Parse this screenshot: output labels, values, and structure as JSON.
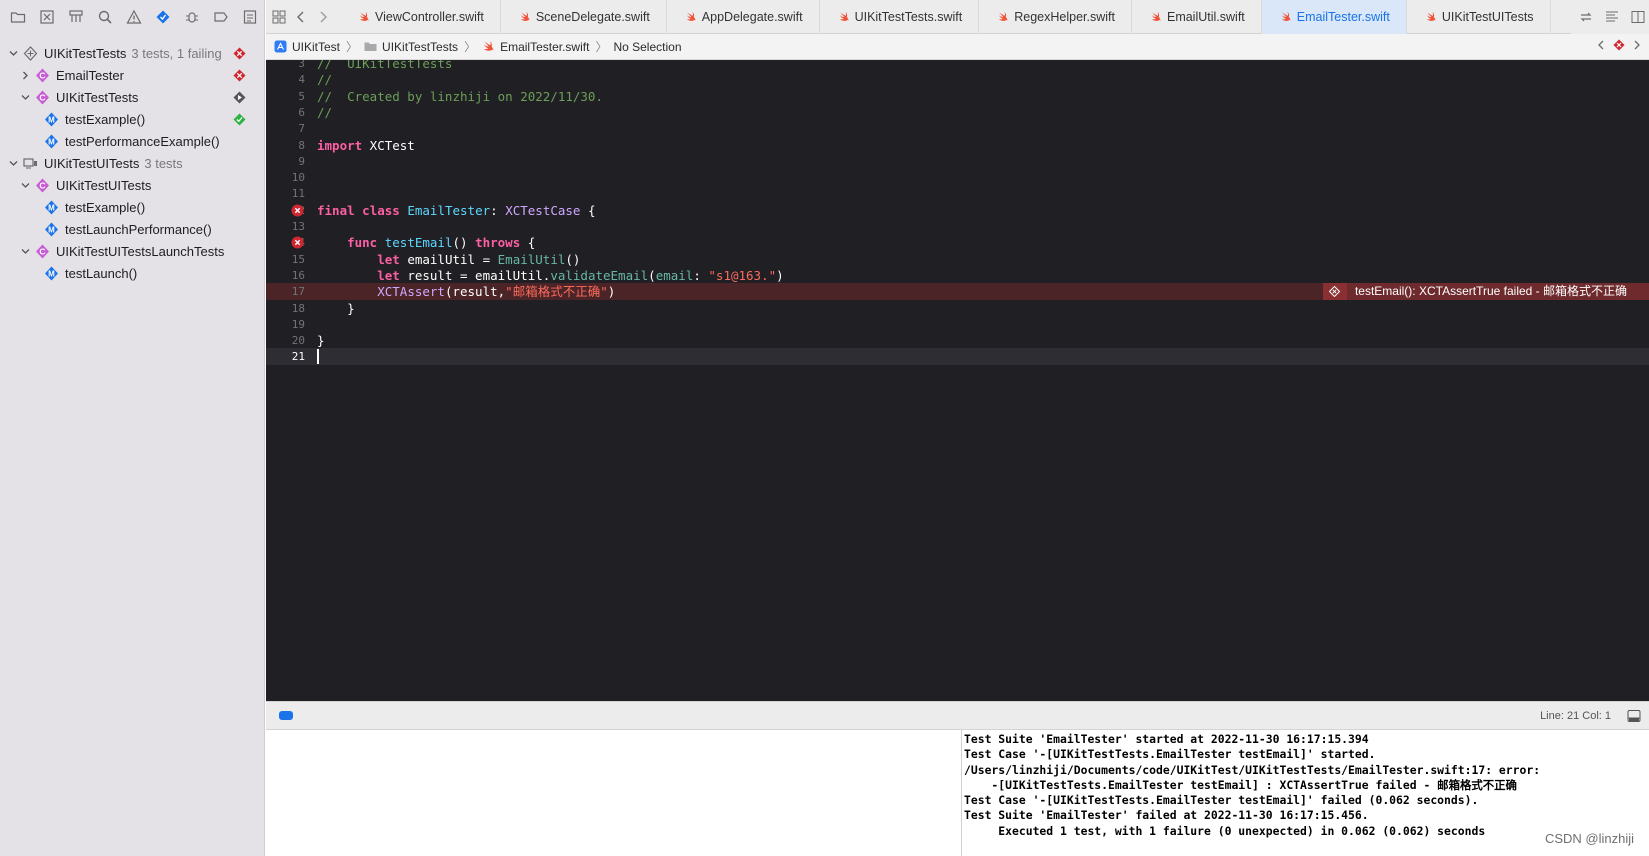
{
  "sidebar": {
    "toolbar_icons": [
      "folder-icon",
      "source-control-icon",
      "symbol-icon",
      "search-icon",
      "warning-icon",
      "test-navigator-icon",
      "debug-icon",
      "breakpoint-icon",
      "report-icon"
    ],
    "tree": [
      {
        "label": "UIKitTestTests",
        "sub": "3 tests, 1 failing",
        "indent": 0,
        "expanded": true,
        "icon": "test-bundle-icon",
        "status": "failed"
      },
      {
        "label": "EmailTester",
        "sub": "",
        "indent": 1,
        "expanded": false,
        "icon": "class-icon",
        "status": "failed"
      },
      {
        "label": "UIKitTestTests",
        "sub": "",
        "indent": 1,
        "expanded": true,
        "icon": "class-icon",
        "status": "run"
      },
      {
        "label": "testExample()",
        "sub": "",
        "indent": 2,
        "expanded": null,
        "icon": "test-method-icon",
        "status": "passed"
      },
      {
        "label": "testPerformanceExample()",
        "sub": "",
        "indent": 2,
        "expanded": null,
        "icon": "test-method-icon",
        "status": ""
      },
      {
        "label": "UIKitTestUITests",
        "sub": "3 tests",
        "indent": 0,
        "expanded": true,
        "icon": "ui-test-bundle-icon",
        "status": ""
      },
      {
        "label": "UIKitTestUITests",
        "sub": "",
        "indent": 1,
        "expanded": true,
        "icon": "class-icon",
        "status": ""
      },
      {
        "label": "testExample()",
        "sub": "",
        "indent": 2,
        "expanded": null,
        "icon": "test-method-icon",
        "status": ""
      },
      {
        "label": "testLaunchPerformance()",
        "sub": "",
        "indent": 2,
        "expanded": null,
        "icon": "test-method-icon",
        "status": ""
      },
      {
        "label": "UIKitTestUITestsLaunchTests",
        "sub": "",
        "indent": 1,
        "expanded": true,
        "icon": "class-icon",
        "status": ""
      },
      {
        "label": "testLaunch()",
        "sub": "",
        "indent": 2,
        "expanded": null,
        "icon": "test-method-icon",
        "status": ""
      }
    ]
  },
  "tabs": [
    {
      "label": "ViewController.swift",
      "active": false
    },
    {
      "label": "SceneDelegate.swift",
      "active": false
    },
    {
      "label": "AppDelegate.swift",
      "active": false
    },
    {
      "label": "UIKitTestTests.swift",
      "active": false
    },
    {
      "label": "RegexHelper.swift",
      "active": false
    },
    {
      "label": "EmailUtil.swift",
      "active": false
    },
    {
      "label": "EmailTester.swift",
      "active": true
    },
    {
      "label": "UIKitTestUITests",
      "active": false
    }
  ],
  "jumpbar": {
    "project": "UIKitTest",
    "group": "UIKitTestTests",
    "file": "EmailTester.swift",
    "selection": "No Selection"
  },
  "editor": {
    "lines": [
      {
        "n": "3",
        "tokens": [
          [
            "cm",
            "//  UIKitTestTests"
          ]
        ]
      },
      {
        "n": "4",
        "tokens": [
          [
            "cm",
            "//"
          ]
        ]
      },
      {
        "n": "5",
        "tokens": [
          [
            "cm",
            "//  Created by linzhiji on 2022/11/30."
          ]
        ]
      },
      {
        "n": "6",
        "tokens": [
          [
            "cm",
            "//"
          ]
        ]
      },
      {
        "n": "7",
        "tokens": []
      },
      {
        "n": "8",
        "tokens": [
          [
            "kw",
            "import"
          ],
          [
            "",
            " XCTest"
          ]
        ]
      },
      {
        "n": "9",
        "tokens": []
      },
      {
        "n": "10",
        "tokens": []
      },
      {
        "n": "11",
        "tokens": []
      },
      {
        "n": "12",
        "error_badge": true,
        "tokens": [
          [
            "kw",
            "final"
          ],
          [
            "",
            " "
          ],
          [
            "kw",
            "class"
          ],
          [
            "",
            " "
          ],
          [
            "ty",
            "EmailTester"
          ],
          [
            "",
            ": "
          ],
          [
            "cls",
            "XCTestCase"
          ],
          [
            "",
            " {"
          ]
        ]
      },
      {
        "n": "13",
        "tokens": []
      },
      {
        "n": "14",
        "error_badge": true,
        "tokens": [
          [
            "",
            "    "
          ],
          [
            "kw",
            "func"
          ],
          [
            "",
            " "
          ],
          [
            "ty",
            "testEmail"
          ],
          [
            "",
            "() "
          ],
          [
            "kw",
            "throws"
          ],
          [
            "",
            " {"
          ]
        ]
      },
      {
        "n": "15",
        "tokens": [
          [
            "",
            "        "
          ],
          [
            "kw",
            "let"
          ],
          [
            "",
            " emailUtil = "
          ],
          [
            "fn",
            "EmailUtil"
          ],
          [
            "",
            "()"
          ]
        ]
      },
      {
        "n": "16",
        "tokens": [
          [
            "",
            "        "
          ],
          [
            "kw",
            "let"
          ],
          [
            "",
            " result = emailUtil."
          ],
          [
            "fn",
            "validateEmail"
          ],
          [
            "",
            "("
          ],
          [
            "par",
            "email"
          ],
          [
            "",
            ": "
          ],
          [
            "str",
            "\"s1@163.\""
          ],
          [
            "",
            ")"
          ]
        ]
      },
      {
        "n": "17",
        "error": true,
        "tokens": [
          [
            "",
            "        "
          ],
          [
            "cls",
            "XCTAssert"
          ],
          [
            "",
            "(result,"
          ],
          [
            "str",
            "\"邮箱格式不正确\""
          ],
          [
            "",
            ")"
          ]
        ]
      },
      {
        "n": "18",
        "tokens": [
          [
            "",
            "    }"
          ]
        ]
      },
      {
        "n": "19",
        "tokens": []
      },
      {
        "n": "20",
        "tokens": [
          [
            "",
            "}"
          ]
        ]
      },
      {
        "n": "21",
        "current": true,
        "tokens": []
      }
    ],
    "inline_error": "testEmail(): XCTAssertTrue failed - 邮箱格式不正确"
  },
  "debugbar": {
    "line_col": "Line: 21  Col: 1"
  },
  "console": {
    "lines": [
      "Test Suite 'EmailTester' started at 2022-11-30 16:17:15.394",
      "Test Case '-[UIKitTestTests.EmailTester testEmail]' started.",
      "/Users/linzhiji/Documents/code/UIKitTest/UIKitTestTests/EmailTester.swift:17: error:",
      "    -[UIKitTestTests.EmailTester testEmail] : XCTAssertTrue failed - 邮箱格式不正确",
      "Test Case '-[UIKitTestTests.EmailTester testEmail]' failed (0.062 seconds).",
      "Test Suite 'EmailTester' failed at 2022-11-30 16:17:15.456.",
      "     Executed 1 test, with 1 failure (0 unexpected) in 0.062 (0.062) seconds"
    ],
    "watermark": "CSDN @linzhiji"
  },
  "colors": {
    "accent": "#1a73e8",
    "error": "#d0262f",
    "passed": "#2fb344",
    "editor_bg": "#1f1f24",
    "sidebar_bg": "#e5e2e7"
  }
}
